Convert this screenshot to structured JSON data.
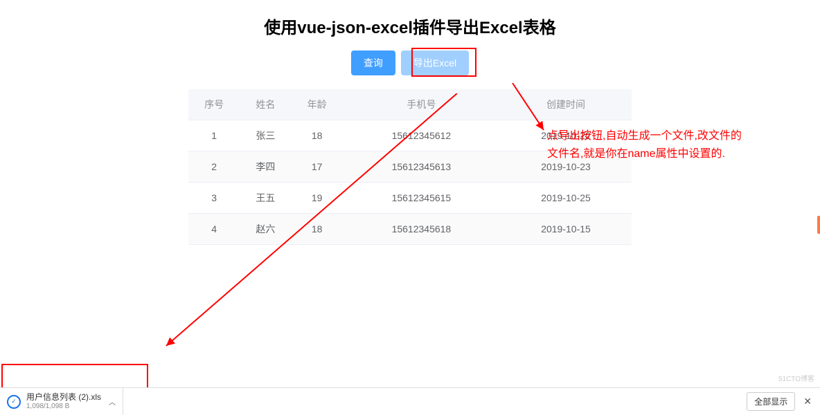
{
  "title": "使用vue-json-excel插件导出Excel表格",
  "buttons": {
    "query": "查询",
    "export": "导出Excel"
  },
  "table": {
    "headers": {
      "index": "序号",
      "name": "姓名",
      "age": "年龄",
      "phone": "手机号",
      "created": "创建时间"
    },
    "rows": [
      {
        "index": "1",
        "name": "张三",
        "age": "18",
        "phone": "15612345612",
        "created": "2019-10-22"
      },
      {
        "index": "2",
        "name": "李四",
        "age": "17",
        "phone": "15612345613",
        "created": "2019-10-23"
      },
      {
        "index": "3",
        "name": "王五",
        "age": "19",
        "phone": "15612345615",
        "created": "2019-10-25"
      },
      {
        "index": "4",
        "name": "赵六",
        "age": "18",
        "phone": "15612345618",
        "created": "2019-10-15"
      }
    ]
  },
  "annotation": {
    "line1": "点导出按钮,自动生成一个文件,改文件的",
    "line2": "文件名,就是你在name属性中设置的."
  },
  "download": {
    "filename": "用户信息列表 (2).xls",
    "size": "1,098/1,098 B",
    "show_all": "全部显示"
  },
  "watermark": "51CTO博客"
}
